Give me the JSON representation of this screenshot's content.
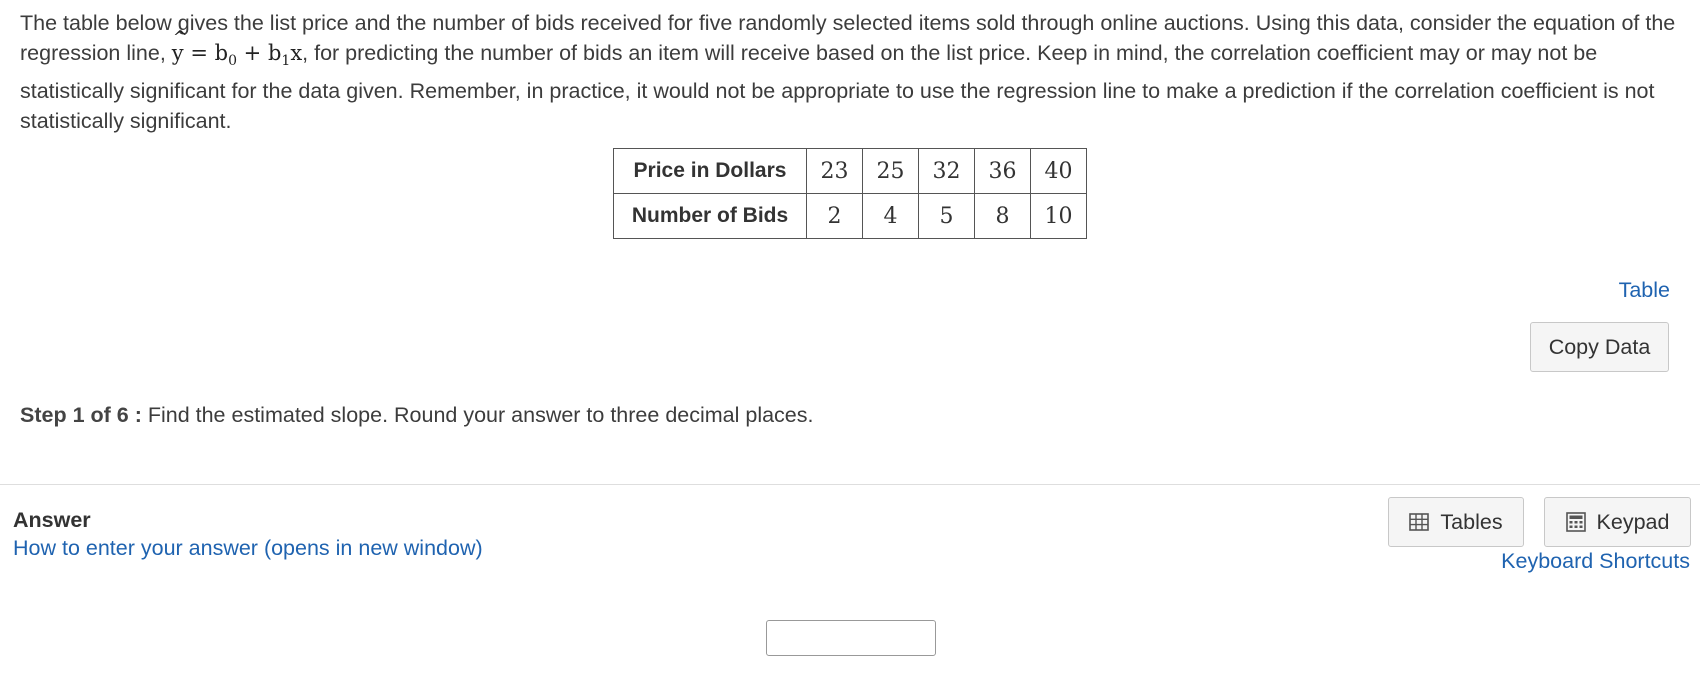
{
  "intro": {
    "part1": "The table below gives the list price and the number of bids received for five randomly selected items sold through online auctions. Using this data, consider the equation of the regression line, ",
    "equation": {
      "lhs": "y",
      "hat": "^",
      "eq": " = ",
      "b": "b",
      "sub0": "0",
      "plus": " + ",
      "sub1": "1",
      "x": "x"
    },
    "part2": ", for predicting the number of bids an item will receive based on the list price. Keep in mind, the correlation coefficient may or may not be statistically significant for the data given. Remember, in practice, it would not be appropriate to use the regression line to make a prediction if the correlation coefficient is not statistically significant."
  },
  "data_table": {
    "rows": [
      {
        "header": "Price in Dollars",
        "values": [
          "23",
          "25",
          "32",
          "36",
          "40"
        ]
      },
      {
        "header": "Number of Bids",
        "values": [
          "2",
          "4",
          "5",
          "8",
          "10"
        ]
      }
    ]
  },
  "table_link": "Table",
  "copy_data": "Copy Data",
  "step": {
    "label": "Step 1 of 6 :",
    "text": " Find the estimated slope. Round your answer to three decimal places."
  },
  "answer": {
    "label": "Answer",
    "howto_link": "How to enter your answer (opens in new window)",
    "input_value": ""
  },
  "tools": {
    "tables_label": "Tables",
    "keypad_label": "Keypad",
    "shortcuts_link": "Keyboard Shortcuts",
    "tables_icon": "table-grid-icon",
    "keypad_icon": "calculator-icon"
  },
  "colors": {
    "link": "#1f63b0",
    "text": "#3c3c3c",
    "button_bg": "#f5f5f5"
  }
}
